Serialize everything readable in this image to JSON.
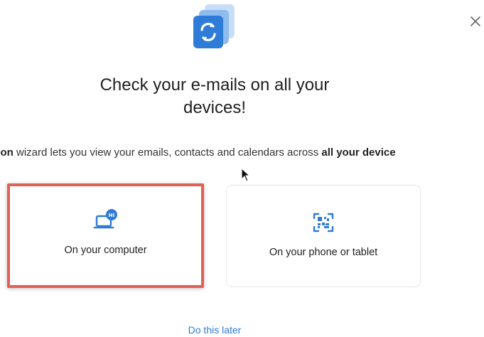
{
  "dialog": {
    "title_line1": "Check your e-mails on all your",
    "title_line2": "devices!",
    "subtitle": {
      "prefix": "uration",
      "middle": " wizard lets you view your emails, contacts and calendars across ",
      "suffix": "all your device"
    },
    "close_icon": "close-icon",
    "hero_icon": "sync-stack-icon"
  },
  "options": [
    {
      "label": "On your computer",
      "icon": "laptop-hi-icon",
      "selected": true
    },
    {
      "label": "On your phone or tablet",
      "icon": "qr-scan-icon",
      "selected": false
    }
  ],
  "footer": {
    "later_label": "Do this later"
  },
  "colors": {
    "accent": "#2f7bd8",
    "highlight": "#e05f57",
    "hero_blue": "#2f7bd8"
  }
}
